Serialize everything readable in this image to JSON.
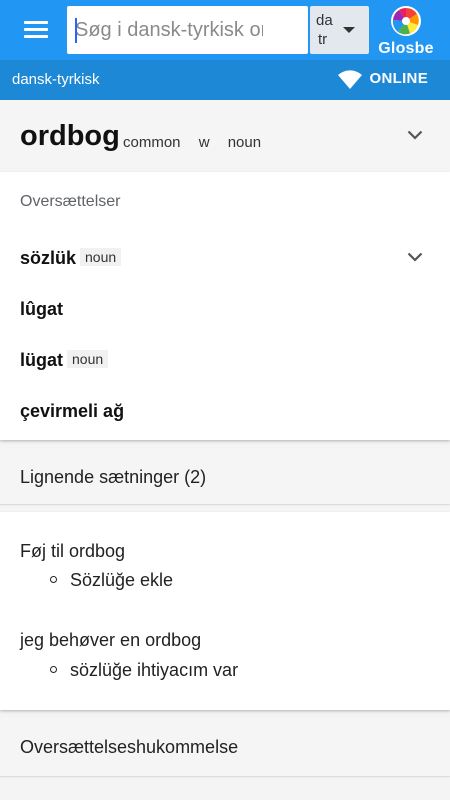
{
  "appbar": {
    "search_placeholder": "Søg i dansk-tyrkisk ordbog",
    "lang_from": "da",
    "lang_to": "tr",
    "logo_text": "Glosbe"
  },
  "subbar": {
    "language_pair": "dansk-tyrkisk",
    "status": "ONLINE"
  },
  "headword": {
    "word": "ordbog",
    "tags": [
      "common",
      "w",
      "noun"
    ]
  },
  "translations": {
    "title": "Oversættelser",
    "items": [
      {
        "text": "sözlük",
        "pos": "noun"
      },
      {
        "text": "lûgat",
        "pos": ""
      },
      {
        "text": "lügat",
        "pos": "noun"
      },
      {
        "text": "çevirmeli ağ",
        "pos": ""
      }
    ]
  },
  "similar": {
    "title": "Lignende sætninger (2)"
  },
  "examples": [
    {
      "source": "Føj til ordbog",
      "target": "Sözlüğe ekle"
    },
    {
      "source": "jeg behøver en ordbog",
      "target": "sözlüğe ihtiyacım var"
    }
  ],
  "memory": {
    "title": "Oversættelseshukommelse"
  },
  "colors": {
    "appbar": "#2196f3",
    "subbar": "#1d88d6",
    "background": "#f4f4f4"
  }
}
